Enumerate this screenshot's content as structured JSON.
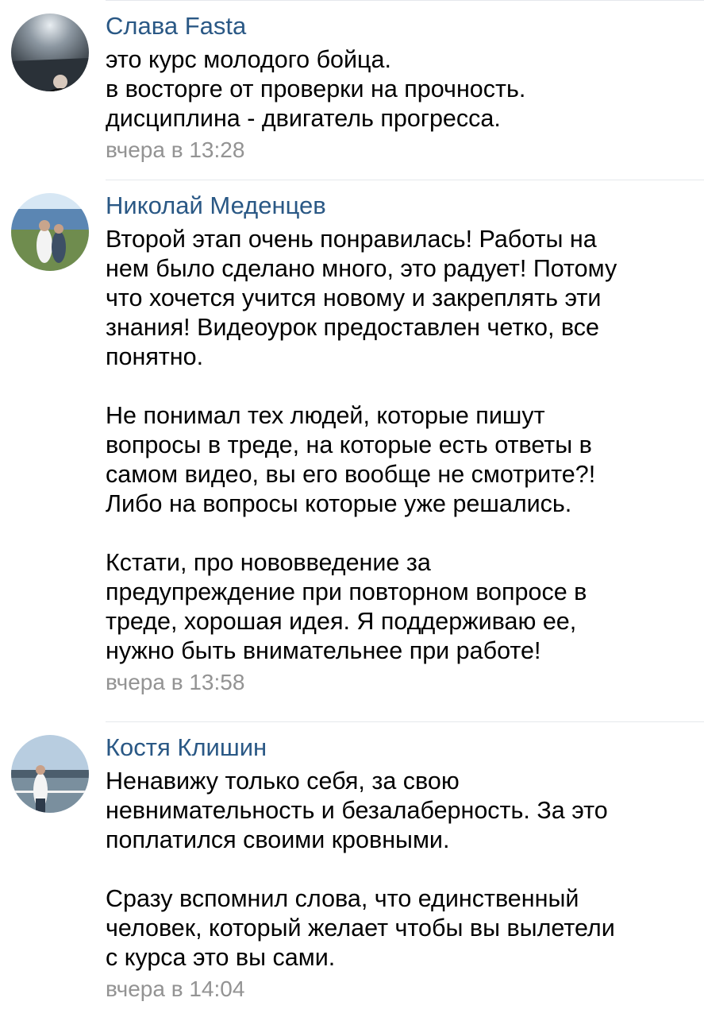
{
  "comments": [
    {
      "author": "Слава Fasta",
      "avatar": "avatar-dark-portrait",
      "paragraphs": [
        "это курс молодого бойца.\nв восторге от проверки на прочность.\nдисциплина - двигатель прогресса."
      ],
      "time": "вчера в 13:28"
    },
    {
      "author": "Николай Меденцев",
      "avatar": "avatar-couple-outdoor",
      "paragraphs": [
        "Второй этап очень понравилась! Работы на\nнем было сделано много, это радует! Потому\nчто хочется учится новому и закреплять эти\nзнания! Видеоурок предоставлен четко, все\nпонятно.",
        "Не понимал тех людей, которые пишут\nвопросы в треде, на которые есть ответы в\nсамом видео, вы его вообще не смотрите?!\nЛибо на вопросы которые уже решались.",
        "Кстати, про нововведение за\nпредупреждение при повторном вопросе в\nтреде, хорошая идея. Я поддерживаю ее,\nнужно быть внимательнее при работе!"
      ],
      "time": "вчера в 13:58"
    },
    {
      "author": "Костя Клишин",
      "avatar": "avatar-man-riverside",
      "paragraphs": [
        "Ненавижу только себя, за свою\nневнимательность и безалаберность. За это\nпоплатился своими кровными.",
        "Сразу вспомнил слова, что единственный\nчеловек, который желает чтобы вы вылетели\nс курса это вы сами."
      ],
      "time": "вчера в 14:04"
    }
  ],
  "colors": {
    "author": "#2a5885",
    "text": "#000000",
    "time": "#939393",
    "separator": "#e5e8ec"
  }
}
